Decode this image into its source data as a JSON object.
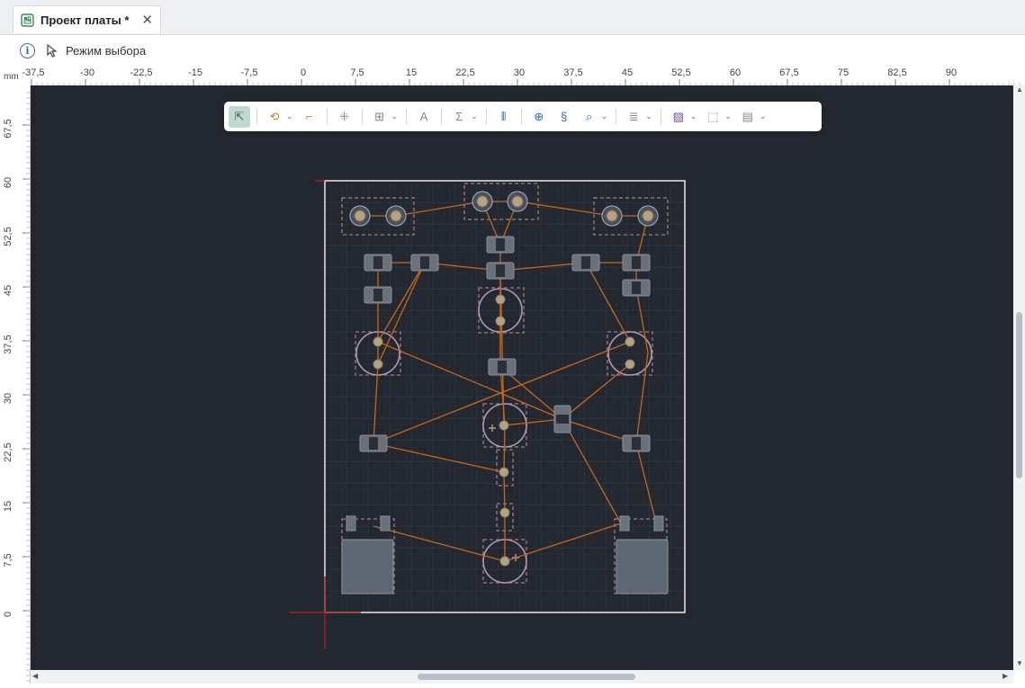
{
  "tab": {
    "title": "Проект платы *",
    "close": "✕"
  },
  "mode": {
    "label": "Режим выбора"
  },
  "ruler": {
    "units": "mm",
    "x_ticks": [
      "-37,5",
      "-30",
      "-22,5",
      "-15",
      "-7,5",
      "0",
      "7,5",
      "15",
      "22,5",
      "30",
      "37,5",
      "45",
      "52,5",
      "60",
      "67,5",
      "75",
      "82,5",
      "90"
    ],
    "y_ticks": [
      "67,5",
      "60",
      "52,5",
      "45",
      "37,5",
      "30",
      "22,5",
      "15",
      "7,5",
      "0"
    ]
  },
  "toolbar": {
    "buttons": [
      {
        "icon": "select-arrow-icon",
        "active": true,
        "caret": false
      },
      {
        "icon": "route-icon",
        "active": false,
        "caret": true
      },
      {
        "icon": "hammer-icon",
        "active": false,
        "caret": false
      },
      {
        "icon": "move-icon",
        "active": false,
        "caret": false
      },
      {
        "icon": "grid-add-icon",
        "active": false,
        "caret": true
      },
      {
        "icon": "text-icon",
        "active": false,
        "caret": false
      },
      {
        "icon": "sigma-icon",
        "active": false,
        "caret": true
      },
      {
        "icon": "component-icon",
        "active": false,
        "caret": false
      },
      {
        "icon": "crosshair-icon",
        "active": false,
        "caret": false
      },
      {
        "icon": "diff-pair-icon",
        "active": false,
        "caret": false
      },
      {
        "icon": "probe-icon",
        "active": false,
        "caret": true
      },
      {
        "icon": "layers-icon",
        "active": false,
        "caret": true
      },
      {
        "icon": "hatch-icon",
        "active": false,
        "caret": true
      },
      {
        "icon": "outline-icon",
        "active": false,
        "caret": true
      },
      {
        "icon": "board-icon",
        "active": false,
        "caret": true
      }
    ]
  },
  "colors": {
    "canvas_bg": "#232830",
    "trace": "#c9661b",
    "board_outline": "#e8e8ea",
    "pad": "#8a8f9a",
    "courtyard": "#a07a8a",
    "origin_cross": "#b3201f"
  }
}
